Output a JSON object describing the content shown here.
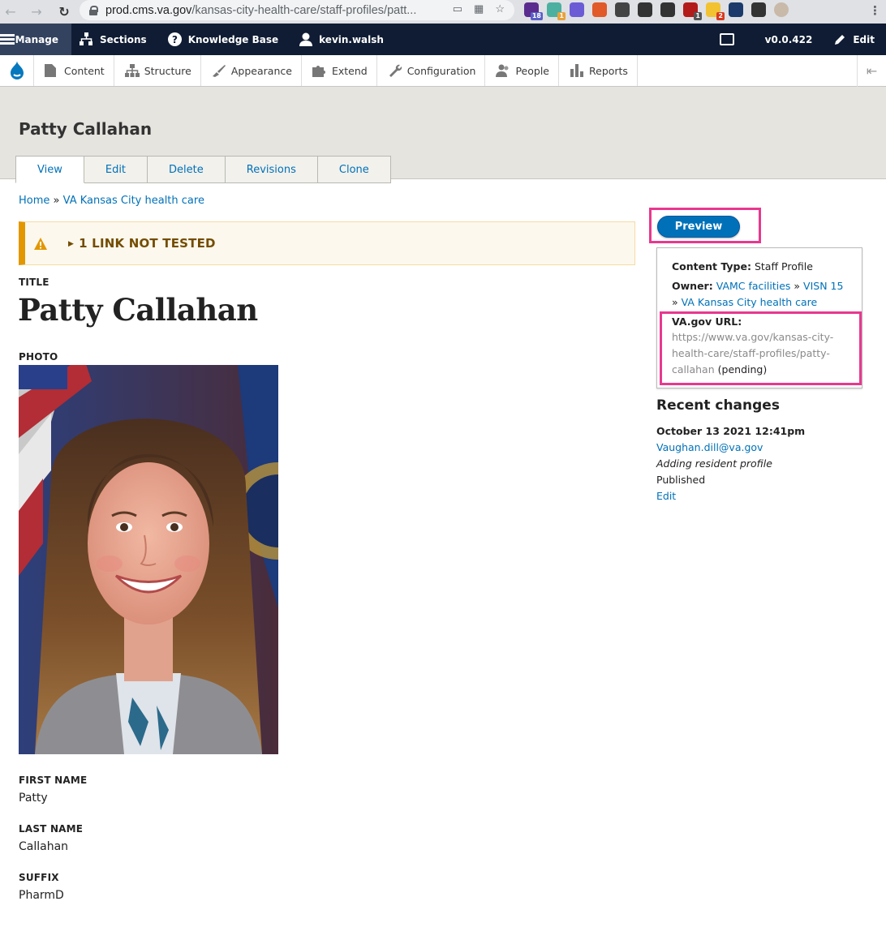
{
  "browser": {
    "url_host": "prod.cms.va.gov",
    "url_path": "/kansas-city-health-care/staff-profiles/patt...",
    "extensions": [
      {
        "name": "graduation-cap-icon",
        "color": "#5b2c8f",
        "badge": "18",
        "badge_color": "#5b5fc7"
      },
      {
        "name": "bubble-icon",
        "color": "#4cb0a0",
        "badge": "1",
        "badge_color": "#e8a13a"
      },
      {
        "name": "asterisk-icon",
        "color": "#6b5cd6",
        "badge": "",
        "badge_color": ""
      },
      {
        "name": "firefox-icon",
        "color": "#e05a2a",
        "badge": "",
        "badge_color": ""
      },
      {
        "name": "terminal-icon",
        "color": "#444",
        "badge": "",
        "badge_color": ""
      },
      {
        "name": "bolt-icon",
        "color": "#333",
        "badge": "",
        "badge_color": ""
      },
      {
        "name": "hash-icon",
        "color": "#333",
        "badge": "",
        "badge_color": ""
      },
      {
        "name": "shield-icon",
        "color": "#b31b1b",
        "badge": "1",
        "badge_color": "#555"
      },
      {
        "name": "bulb-icon",
        "color": "#f2c230",
        "badge": "2",
        "badge_color": "#d9381e"
      },
      {
        "name": "heart-icon",
        "color": "#1b3a6b",
        "badge": "",
        "badge_color": ""
      },
      {
        "name": "puzzle-icon",
        "color": "#333",
        "badge": "",
        "badge_color": ""
      },
      {
        "name": "avatar-icon",
        "color": "#c9b9a8",
        "badge": "",
        "badge_color": ""
      }
    ]
  },
  "toolbar": {
    "manage": "Manage",
    "sections": "Sections",
    "knowledge_base": "Knowledge Base",
    "user": "kevin.walsh",
    "version": "v0.0.422",
    "edit": "Edit"
  },
  "tray": {
    "items": [
      {
        "label": "Content",
        "icon": "file-icon"
      },
      {
        "label": "Structure",
        "icon": "sitemap-icon"
      },
      {
        "label": "Appearance",
        "icon": "paintbrush-icon"
      },
      {
        "label": "Extend",
        "icon": "puzzle-piece-icon"
      },
      {
        "label": "Configuration",
        "icon": "wrench-icon"
      },
      {
        "label": "People",
        "icon": "people-icon"
      },
      {
        "label": "Reports",
        "icon": "bar-chart-icon"
      }
    ]
  },
  "page": {
    "title": "Patty Callahan",
    "tabs": [
      "View",
      "Edit",
      "Delete",
      "Revisions",
      "Clone"
    ]
  },
  "breadcrumb": {
    "home": "Home",
    "separator": "»",
    "parent": "VA Kansas City health care"
  },
  "warning": {
    "text": "1 LINK NOT TESTED"
  },
  "fields": {
    "title_label": "TITLE",
    "title_value": "Patty Callahan",
    "photo_label": "PHOTO",
    "first_name_label": "FIRST NAME",
    "first_name_value": "Patty",
    "last_name_label": "LAST NAME",
    "last_name_value": "Callahan",
    "suffix_label": "SUFFIX",
    "suffix_value": "PharmD"
  },
  "sidebar": {
    "preview_label": "Preview",
    "content_type_label": "Content Type:",
    "content_type_value": "Staff Profile",
    "owner_label": "Owner:",
    "owner_link_1": "VAMC facilities",
    "owner_sep": "»",
    "owner_link_2": "VISN 15",
    "owner_link_3": "VA Kansas City health care",
    "url_label": "VA.gov URL:",
    "url_line_1": "https://www.va.gov/kansas-city-",
    "url_line_2": "health-care/staff-profiles/patty-",
    "url_line_3": "callahan",
    "url_pending": "(pending)",
    "recent_title": "Recent changes",
    "recent_date": "October 13 2021 12:41pm",
    "recent_user": "Vaughan.dill@va.gov",
    "recent_message": "Adding resident profile",
    "recent_status": "Published",
    "recent_edit": "Edit"
  },
  "colors": {
    "toolbar_bg": "#0f1c33",
    "link": "#0071b8",
    "highlight": "#e8388f",
    "warning_accent": "#e29700"
  }
}
